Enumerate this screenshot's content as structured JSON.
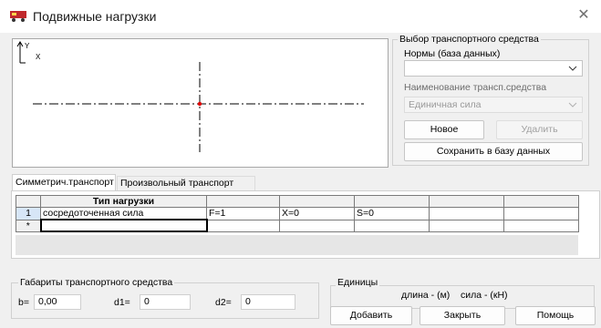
{
  "window": {
    "title": "Подвижные нагрузки",
    "close_glyph": "✕"
  },
  "preview": {
    "axis_y": "Y",
    "axis_x": "X"
  },
  "transport_select": {
    "title": "Выбор транспортного средства",
    "norms_label": "Нормы (база данных)",
    "norms_value": "",
    "vehicle_label": "Наименование трансп.средства",
    "vehicle_value": "Единичная сила",
    "new_button": "Новое",
    "delete_button": "Удалить",
    "save_button": "Сохранить в базу данных"
  },
  "tabs": [
    {
      "label": "Симметрич.транспорт",
      "active": true
    },
    {
      "label": "Произвольный транспорт",
      "active": false
    }
  ],
  "grid": {
    "headers": [
      "",
      "Тип нагрузки",
      "",
      "",
      "",
      "",
      ""
    ],
    "rows": [
      [
        "1",
        "сосредоточенная сила",
        "F=1",
        "X=0",
        "S=0",
        "",
        ""
      ],
      [
        "*",
        "",
        "",
        "",
        "",
        "",
        ""
      ]
    ]
  },
  "dimensions": {
    "title": "Габариты транспортного средства",
    "b_label": "b=",
    "b_value": "0,00",
    "d1_label": "d1=",
    "d1_value": "0",
    "d2_label": "d2=",
    "d2_value": "0"
  },
  "units": {
    "title": "Единицы",
    "text": "длина - (м)    сила - (кН)"
  },
  "footer": {
    "add_button": "Добавить",
    "close_button": "Закрыть",
    "help_button": "Помощь"
  },
  "colors": {
    "accent_point": "#e00000",
    "icon_red": "#c0282c"
  }
}
